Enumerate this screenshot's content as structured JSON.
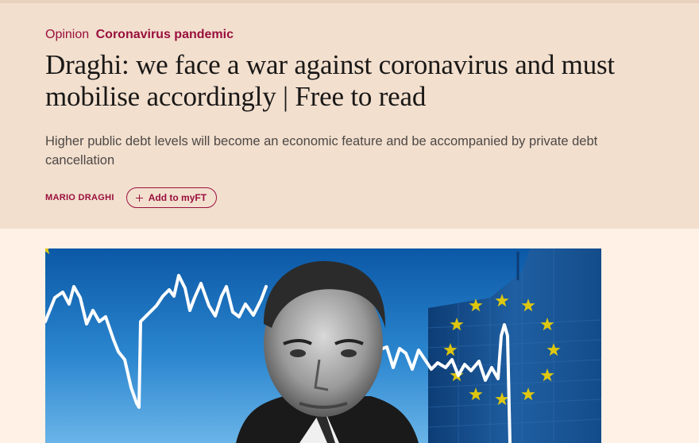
{
  "article": {
    "kicker_prefix": "Opinion",
    "kicker_topic": "Coronavirus pandemic",
    "headline": "Draghi: we face a war against coronavirus and must mobilise accordingly | Free to read",
    "standfirst": "Higher public debt levels will become an economic feature and be accompanied by private debt cancellation",
    "author": "MARIO DRAGHI",
    "myft_button_label": "Add to myFT"
  },
  "hero_image": {
    "description_icon": "portrait-with-chart-line-and-eu-flag"
  },
  "colors": {
    "header_background": "#f2dfce",
    "page_background": "#fff1e5",
    "accent": "#990f3d",
    "headline": "#1a1817",
    "standfirst": "#4d4845"
  }
}
